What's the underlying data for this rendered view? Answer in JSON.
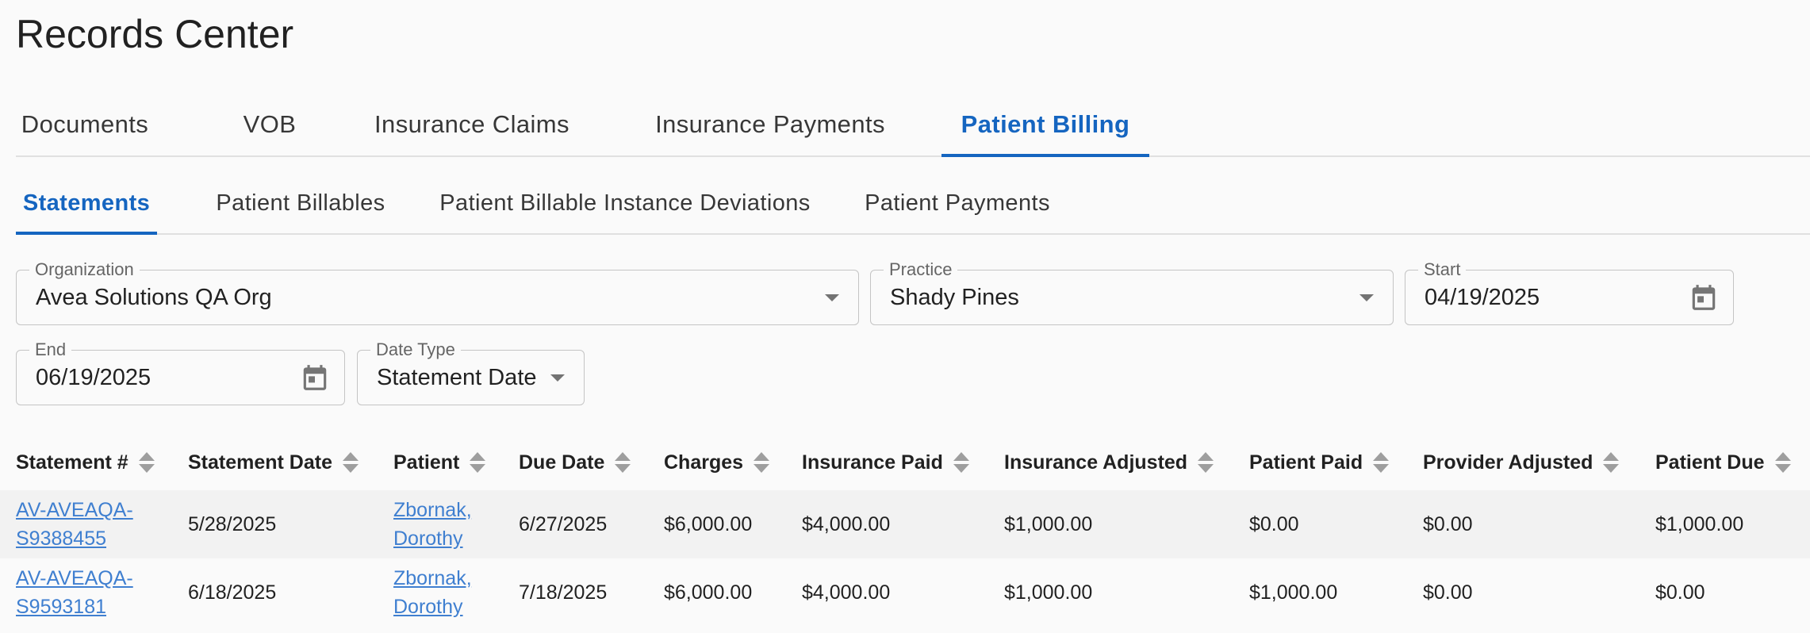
{
  "page": {
    "title": "Records Center"
  },
  "main_tabs": [
    {
      "label": "Documents",
      "active": false
    },
    {
      "label": "VOB",
      "active": false
    },
    {
      "label": "Insurance Claims",
      "active": false
    },
    {
      "label": "Insurance Payments",
      "active": false
    },
    {
      "label": "Patient Billing",
      "active": true
    }
  ],
  "sub_tabs": [
    {
      "label": "Statements",
      "active": true
    },
    {
      "label": "Patient Billables",
      "active": false
    },
    {
      "label": "Patient Billable Instance Deviations",
      "active": false
    },
    {
      "label": "Patient Payments",
      "active": false
    }
  ],
  "filters": {
    "organization": {
      "label": "Organization",
      "value": "Avea Solutions QA Org",
      "icon": "chevron-down-icon"
    },
    "practice": {
      "label": "Practice",
      "value": "Shady Pines",
      "icon": "chevron-down-icon"
    },
    "start": {
      "label": "Start",
      "value": "04/19/2025",
      "icon": "calendar-icon"
    },
    "end": {
      "label": "End",
      "value": "06/19/2025",
      "icon": "calendar-icon"
    },
    "date_type": {
      "label": "Date Type",
      "value": "Statement Date",
      "icon": "chevron-down-icon"
    }
  },
  "table": {
    "columns": [
      "Statement #",
      "Statement Date",
      "Patient",
      "Due Date",
      "Charges",
      "Insurance Paid",
      "Insurance Adjusted",
      "Patient Paid",
      "Provider Adjusted",
      "Patient Due"
    ],
    "rows": [
      {
        "statement_line1": "AV-AVEAQA-",
        "statement_line2": "S9388455",
        "statement_date": "5/28/2025",
        "patient_line1": "Zbornak,",
        "patient_line2": "Dorothy",
        "due_date": "6/27/2025",
        "charges": "$6,000.00",
        "insurance_paid": "$4,000.00",
        "insurance_adjusted": "$1,000.00",
        "patient_paid": "$0.00",
        "provider_adjusted": "$0.00",
        "patient_due": "$1,000.00"
      },
      {
        "statement_line1": "AV-AVEAQA-",
        "statement_line2": "S9593181",
        "statement_date": "6/18/2025",
        "patient_line1": "Zbornak,",
        "patient_line2": "Dorothy",
        "due_date": "7/18/2025",
        "charges": "$6,000.00",
        "insurance_paid": "$4,000.00",
        "insurance_adjusted": "$1,000.00",
        "patient_paid": "$1,000.00",
        "provider_adjusted": "$0.00",
        "patient_due": "$0.00"
      }
    ]
  },
  "colors": {
    "accent": "#1565c0",
    "link": "#3f7fd0",
    "divider": "#e0e0e0"
  }
}
